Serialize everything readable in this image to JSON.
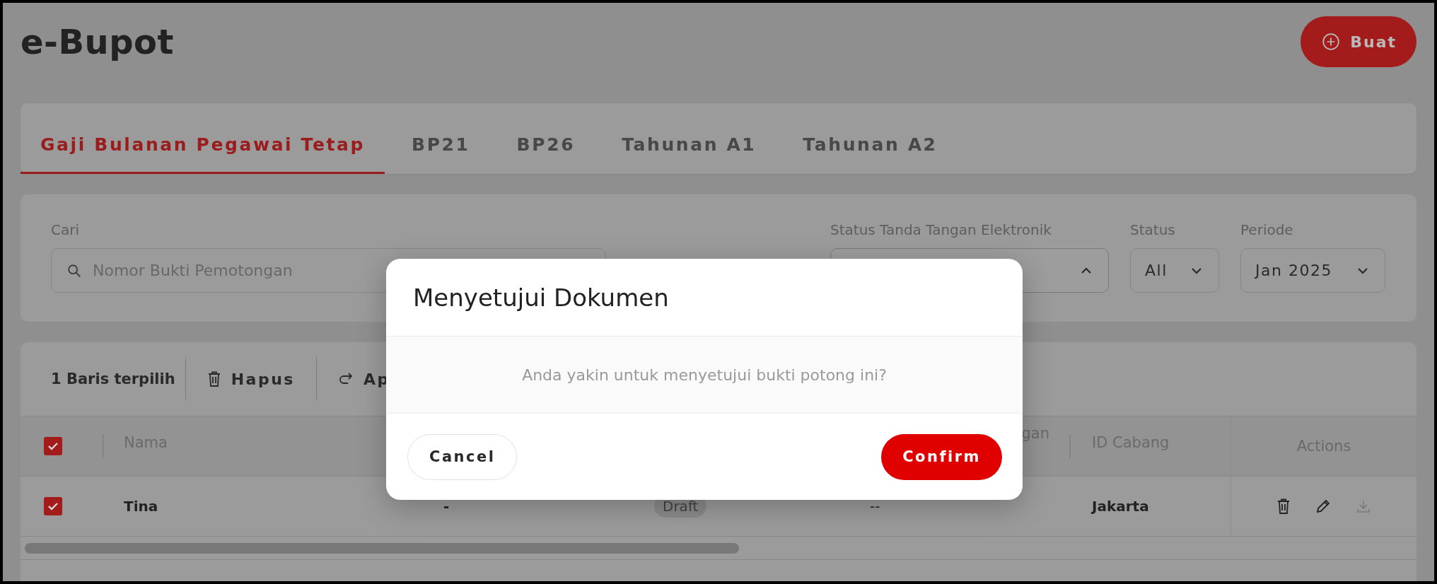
{
  "page": {
    "title": "e-Bupot",
    "create_button": "Buat"
  },
  "tabs": [
    {
      "label": "Gaji Bulanan Pegawai Tetap",
      "selected": true
    },
    {
      "label": "BP21",
      "selected": false
    },
    {
      "label": "BP26",
      "selected": false
    },
    {
      "label": "Tahunan A1",
      "selected": false
    },
    {
      "label": "Tahunan A2",
      "selected": false
    }
  ],
  "filters": {
    "search": {
      "label": "Cari",
      "placeholder": "Nomor Bukti Pemotongan"
    },
    "signature_status": {
      "label": "Status Tanda Tangan Elektronik",
      "expanded": true
    },
    "status": {
      "label": "Status",
      "value": "All",
      "expanded": false
    },
    "period": {
      "label": "Periode",
      "value": "Jan 2025",
      "expanded": false
    }
  },
  "toolbar": {
    "selection": "1 Baris terpilih",
    "actions": [
      {
        "kind": "delete",
        "label": "Hapus"
      },
      {
        "kind": "approve",
        "label": "Ap"
      }
    ]
  },
  "table": {
    "all_checked": true,
    "columns": {
      "name": "Nama",
      "column_4": "gan",
      "branch_id": "ID Cabang",
      "actions": "Actions"
    },
    "rows": [
      {
        "checked": true,
        "name": "Tina",
        "column_2": "-",
        "status": "Draft",
        "column_4": "--",
        "branch_id": "Jakarta",
        "actions": [
          {
            "kind": "delete",
            "disabled": false
          },
          {
            "kind": "edit",
            "disabled": false
          },
          {
            "kind": "download",
            "disabled": true
          }
        ]
      }
    ]
  },
  "dialog": {
    "title": "Menyetujui Dokumen",
    "message": "Anda yakin untuk menyetujui bukti potong ini?",
    "buttons": [
      {
        "kind": "secondary",
        "label": "Cancel"
      },
      {
        "kind": "primary",
        "label": "Confirm"
      }
    ]
  }
}
